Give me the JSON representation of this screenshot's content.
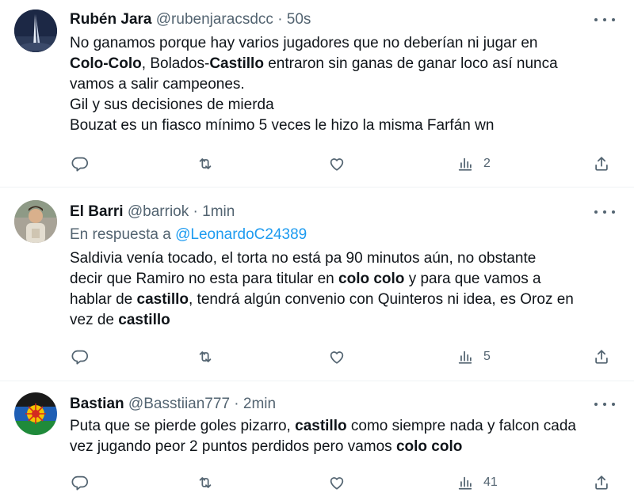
{
  "tweets": [
    {
      "name": "Rubén Jara",
      "handle": "@rubenjaracsdcc",
      "sep": "·",
      "time": "50s",
      "line1_a": "No ganamos porque hay varios jugadores que no deberían ni jugar en",
      "line2_bold1": "Colo-Colo",
      "line2_a": ", Bolados-",
      "line2_bold2": "Castillo",
      "line2_b": " entraron sin ganas de ganar loco así nunca",
      "line3": "vamos a salir campeones.",
      "line4": "Gil y sus decisiones de mierda",
      "line5": "Bouzat es un fiasco mínimo 5 veces le hizo la misma Farfán wn",
      "views": "2"
    },
    {
      "name": "El Barri",
      "handle": "@barriok",
      "sep": "·",
      "time": "1min",
      "reply_prefix": "En respuesta a",
      "reply_mention": "@LeonardoC24389",
      "l1": "Saldivia venía tocado, el torta no está pa 90 minutos aún, no obstante",
      "l2_a": "decir que Ramiro no esta para titular en ",
      "l2_bold": "colo colo",
      "l2_b": " y para que vamos a",
      "l3_a": "hablar de ",
      "l3_bold": "castillo",
      "l3_b": ", tendrá algún convenio con Quinteros ni idea, es Oroz en",
      "l4_a": "vez de ",
      "l4_bold": "castillo",
      "views": "5"
    },
    {
      "name": "Bastian",
      "handle": "@Basstiian777",
      "sep": "·",
      "time": "2min",
      "l1_a": "Puta que se pierde goles pizarro, ",
      "l1_bold": "castillo",
      "l1_b": " como siempre nada y falcon cada",
      "l2_a": "vez jugando peor 2 puntos perdidos pero vamos ",
      "l2_bold": "colo colo",
      "views": "41"
    }
  ],
  "icons": [
    "avatar",
    "more-icon",
    "reply-icon",
    "retweet-icon",
    "like-icon",
    "views-icon",
    "share-icon"
  ],
  "colors": {
    "text": "#0f1419",
    "secondary": "#536471",
    "link": "#1d9bf0",
    "divider": "#eff3f4"
  }
}
